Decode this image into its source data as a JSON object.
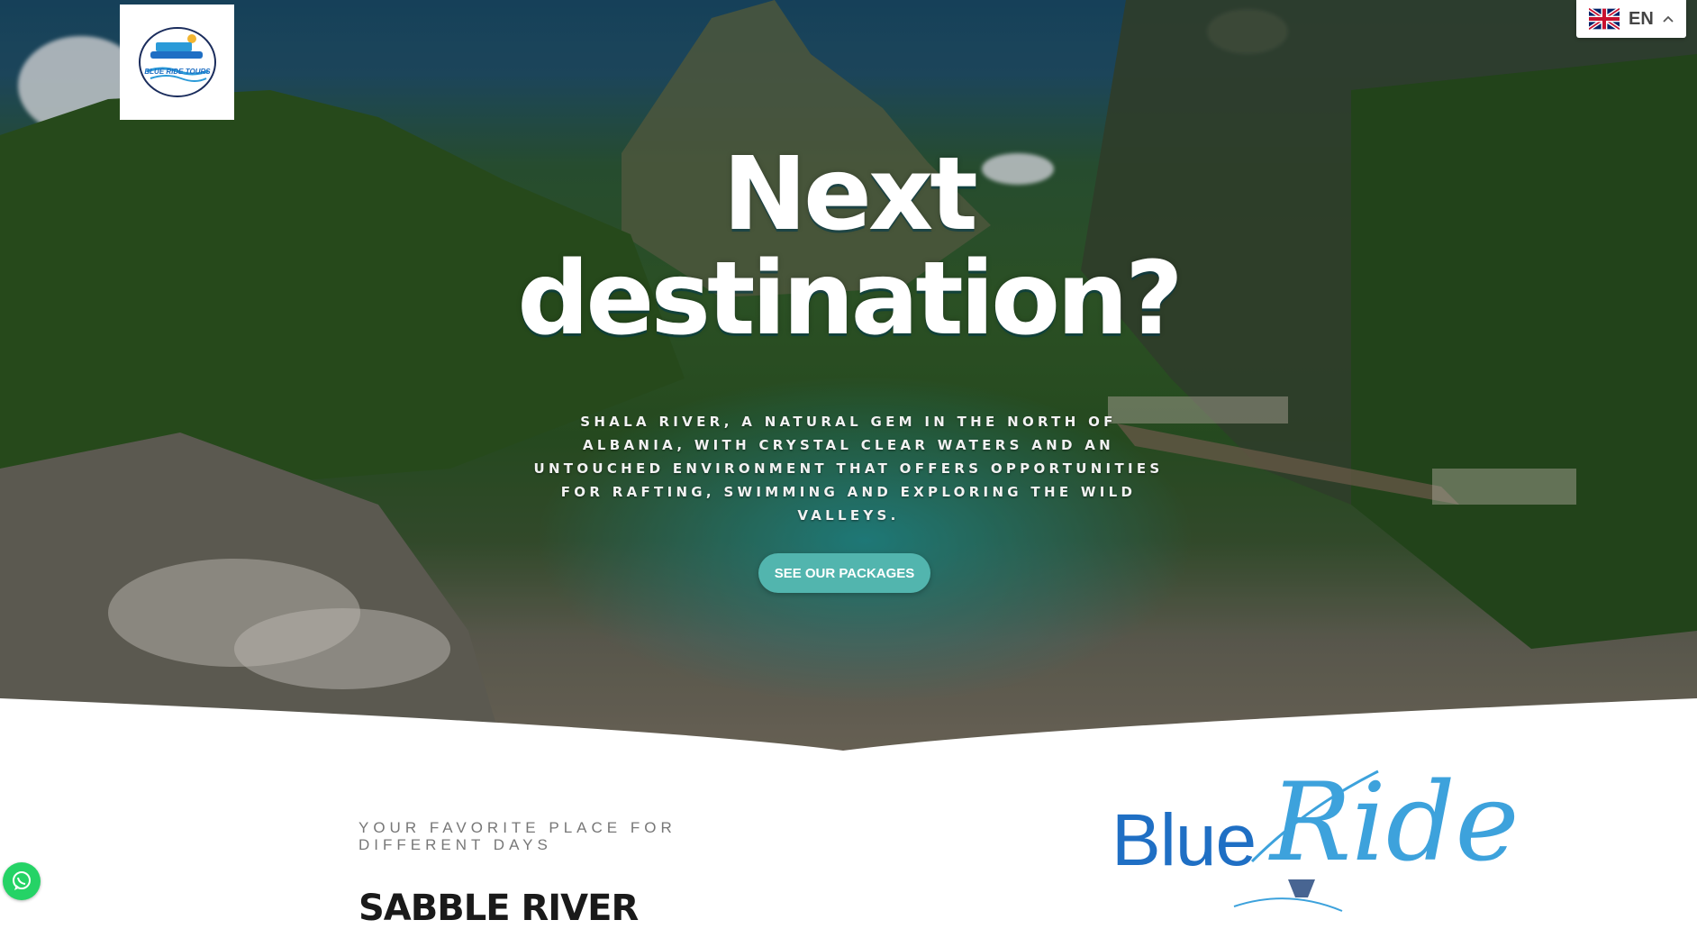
{
  "header": {
    "logo": {
      "icon": "blue-ride-tours-logo",
      "text": "BLUE RIDE TOURS"
    },
    "language": {
      "code": "EN",
      "flag_icon": "uk-flag-icon",
      "chevron_icon": "chevron-up-icon"
    }
  },
  "hero": {
    "title_line1": "Next",
    "title_line2": "destination?",
    "subtitle": "SHALA RIVER, A NATURAL GEM IN THE NORTH OF ALBANIA, WITH CRYSTAL CLEAR WATERS AND AN UNTOUCHED ENVIRONMENT THAT OFFERS OPPORTUNITIES FOR RAFTING, SWIMMING AND EXPLORING THE WILD VALLEYS.",
    "cta_label": "SEE OUR PACKAGES"
  },
  "intro": {
    "kicker": "YOUR FAVORITE PLACE FOR DIFFERENT DAYS",
    "title": "SABBLE RIVER"
  },
  "brand": {
    "word1": "Blue",
    "word2": "Ride"
  },
  "floating": {
    "whatsapp_icon": "whatsapp-icon"
  },
  "colors": {
    "accent": "#52b5ae",
    "brand_blue": "#1f6fc4",
    "brand_light_blue": "#3da2dc"
  }
}
